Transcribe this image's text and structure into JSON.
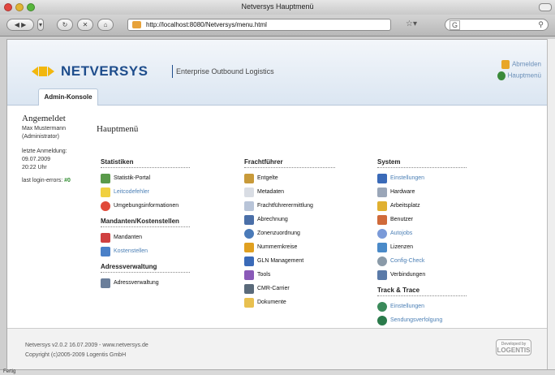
{
  "window": {
    "title": "Netversys Hauptmenü"
  },
  "browser": {
    "url": "http://localhost:8080/Netversys/menu.html",
    "search_engine": "G",
    "status": "Fertig"
  },
  "header": {
    "brand": "NETVERSYS",
    "subtitle": "Enterprise Outbound Logistics",
    "brand_color": "#1e4d8c",
    "accent_color": "#f2b70e",
    "links": [
      {
        "label": "Abmelden",
        "icon": "logout-icon"
      },
      {
        "label": "Hauptmenü",
        "icon": "home-icon"
      }
    ],
    "tab": "Admin-Konsole"
  },
  "sidebar": {
    "heading": "Angemeldet",
    "user": "Max Mustermann",
    "role": "(Administrator)",
    "last_login_label": "letzte Anmeldung:",
    "last_login_date": "09.07.2009",
    "last_login_time": "20:22 Uhr",
    "errors_label": "last login-errors:",
    "errors_value": "#0"
  },
  "main": {
    "title": "Hauptmenü",
    "col1": {
      "statistiken": {
        "heading": "Statistiken",
        "items": [
          {
            "label": "Statistik-Portal",
            "icon": "chart-icon"
          },
          {
            "label": "Leitcodefehler",
            "icon": "warning-icon"
          },
          {
            "label": "Umgebungsinformationen",
            "icon": "lifebuoy-icon"
          }
        ]
      },
      "mandanten": {
        "heading": "Mandanten/Kostenstellen",
        "items": [
          {
            "label": "Mandanten",
            "icon": "hat-icon"
          },
          {
            "label": "Kostenstellen",
            "icon": "puzzle-icon"
          }
        ]
      },
      "adressen": {
        "heading": "Adressverwaltung",
        "items": [
          {
            "label": "Adressverwaltung",
            "icon": "addressbook-icon"
          }
        ]
      }
    },
    "col2": {
      "heading": "Frachtführer",
      "items": [
        {
          "label": "Entgelte",
          "icon": "moneybag-icon"
        },
        {
          "label": "Metadaten",
          "icon": "document-icon"
        },
        {
          "label": "Frachtführerermittlung",
          "icon": "route-icon"
        },
        {
          "label": "Abrechnung",
          "icon": "invoice-icon"
        },
        {
          "label": "Zonenzuordnung",
          "icon": "globe-icon"
        },
        {
          "label": "Nummernkreise",
          "icon": "pen-icon"
        },
        {
          "label": "GLN Management",
          "icon": "network-icon"
        },
        {
          "label": "Tools",
          "icon": "toolbox-icon"
        },
        {
          "label": "CMR-Carrier",
          "icon": "truck-icon"
        },
        {
          "label": "Dokumente",
          "icon": "documents-icon"
        }
      ]
    },
    "col3": {
      "system": {
        "heading": "System",
        "items": [
          {
            "label": "Einstellungen",
            "icon": "checklist-icon"
          },
          {
            "label": "Hardware",
            "icon": "hardware-icon"
          },
          {
            "label": "Arbeitsplatz",
            "icon": "key-icon"
          },
          {
            "label": "Benutzer",
            "icon": "users-icon"
          },
          {
            "label": "Autojobs",
            "icon": "clock-icon"
          },
          {
            "label": "Lizenzen",
            "icon": "license-icon"
          },
          {
            "label": "Config-Check",
            "icon": "gears-icon"
          },
          {
            "label": "Verbindungen",
            "icon": "connection-icon"
          }
        ]
      },
      "track": {
        "heading": "Track & Trace",
        "items": [
          {
            "label": "Einstellungen",
            "icon": "globe-icon"
          },
          {
            "label": "Sendungsverfolgung",
            "icon": "globe-icon"
          }
        ]
      }
    }
  },
  "footer": {
    "version": "Netversys v2.0.2 16.07.2009 - www.netversys.de",
    "copyright": "Copyright (c)2005-2009 Logentis GmbH",
    "badge_top": "Developed by",
    "badge_brand": "LOGENTIS"
  }
}
